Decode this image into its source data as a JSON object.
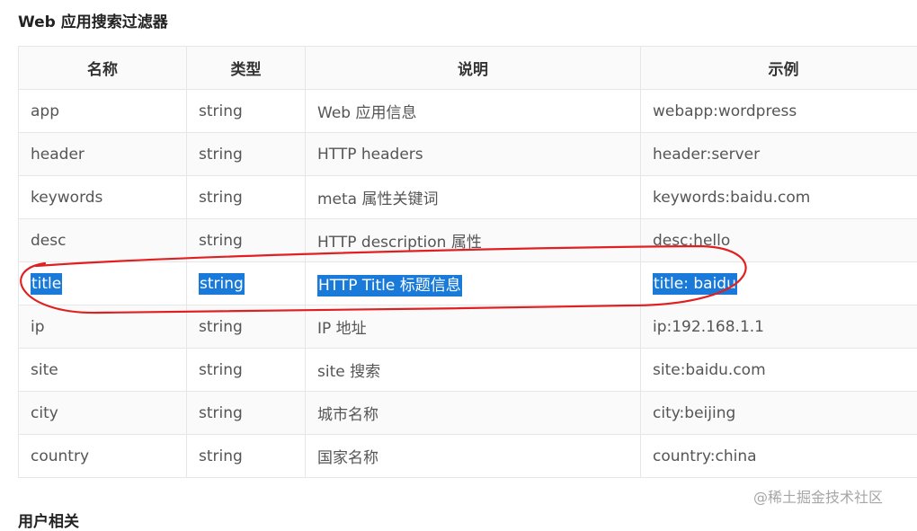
{
  "section_title": "Web 应用搜索过滤器",
  "table": {
    "headers": [
      "名称",
      "类型",
      "说明",
      "示例"
    ],
    "rows": [
      [
        "app",
        "string",
        "Web 应用信息",
        "webapp:wordpress"
      ],
      [
        "header",
        "string",
        "HTTP headers",
        "header:server"
      ],
      [
        "keywords",
        "string",
        "meta 属性关键词",
        "keywords:baidu.com"
      ],
      [
        "desc",
        "string",
        "HTTP description 属性",
        "desc:hello"
      ],
      [
        "title",
        "string",
        "HTTP Title 标题信息",
        "title: baidu"
      ],
      [
        "ip",
        "string",
        "IP 地址",
        "ip:192.168.1.1"
      ],
      [
        "site",
        "string",
        "site 搜索",
        "site:baidu.com"
      ],
      [
        "city",
        "string",
        "城市名称",
        "city:beijing"
      ],
      [
        "country",
        "string",
        "国家名称",
        "country:china"
      ]
    ]
  },
  "watermark": "@稀土掘金技术社区",
  "next_heading": "用户相关",
  "colors": {
    "selection": "#1a7ad9",
    "annotation_circle": "#e02020"
  }
}
